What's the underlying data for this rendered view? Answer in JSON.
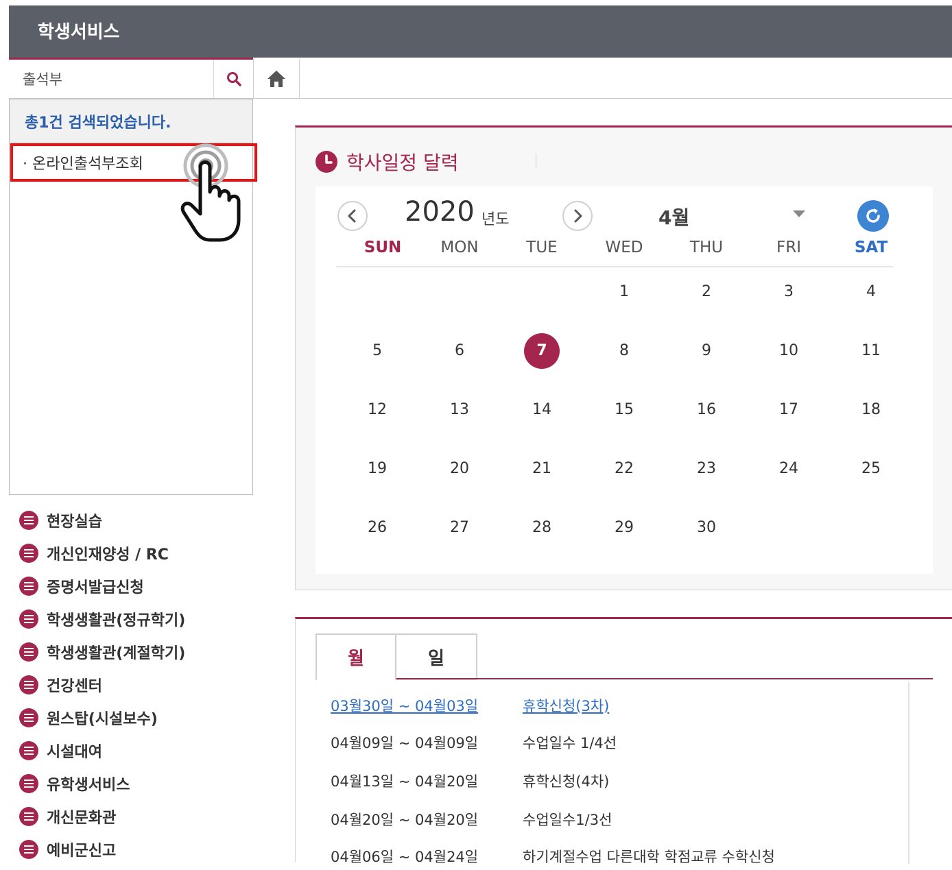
{
  "header": {
    "title": "학생서비스"
  },
  "search": {
    "value": "출석부"
  },
  "results": {
    "summary": "총1건 검색되었습니다.",
    "items": [
      {
        "label": "· 온라인출석부조회"
      }
    ]
  },
  "menu": {
    "items": [
      {
        "label": "현장실습"
      },
      {
        "label": "개신인재양성 / RC"
      },
      {
        "label": "증명서발급신청"
      },
      {
        "label": "학생생활관(정규학기)"
      },
      {
        "label": "학생생활관(계절학기)"
      },
      {
        "label": "건강센터"
      },
      {
        "label": "원스탑(시설보수)"
      },
      {
        "label": "시설대여"
      },
      {
        "label": "유학생서비스"
      },
      {
        "label": "개신문화관"
      },
      {
        "label": "예비군신고"
      }
    ]
  },
  "calendar": {
    "title": "학사일정 달력",
    "year": "2020",
    "year_unit": "년도",
    "month": "4월",
    "today": "7",
    "weekdays": [
      "SUN",
      "MON",
      "TUE",
      "WED",
      "THU",
      "FRI",
      "SAT"
    ],
    "weeks": [
      [
        "",
        "",
        "",
        "1",
        "2",
        "3",
        "4"
      ],
      [
        "5",
        "6",
        "7",
        "8",
        "9",
        "10",
        "11"
      ],
      [
        "12",
        "13",
        "14",
        "15",
        "16",
        "17",
        "18"
      ],
      [
        "19",
        "20",
        "21",
        "22",
        "23",
        "24",
        "25"
      ],
      [
        "26",
        "27",
        "28",
        "29",
        "30",
        "",
        ""
      ]
    ],
    "colors": {
      "sunday": "#a4264f",
      "saturday": "#2f6ec4",
      "accent": "#a4264f"
    }
  },
  "schedule": {
    "tabs": [
      {
        "label": "월"
      },
      {
        "label": "일"
      }
    ],
    "rows": [
      {
        "date": "03월30일 ~ 04월03일",
        "event": "휴학신청(3차)"
      },
      {
        "date": "04월09일 ~ 04월09일",
        "event": "수업일수 1/4선"
      },
      {
        "date": "04월13일 ~ 04월20일",
        "event": "휴학신청(4차)"
      },
      {
        "date": "04월20일 ~ 04월20일",
        "event": "수업일수1/3선"
      },
      {
        "date": "04월06일 ~ 04월24일",
        "event": "하기계절수업 다른대학 학점교류 수학신청"
      }
    ]
  },
  "icons": {
    "search": "search-icon",
    "home": "home-icon",
    "clock": "clock-icon",
    "prev": "chevron-left-icon",
    "next": "chevron-right-icon",
    "refresh": "refresh-icon",
    "menu_item": "list-icon",
    "cursor": "hand-pointer-icon"
  }
}
